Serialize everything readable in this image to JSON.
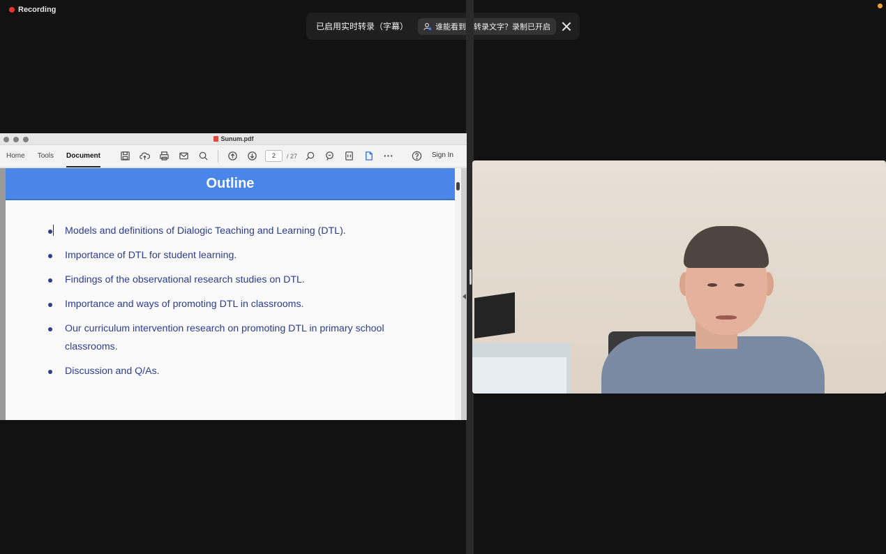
{
  "recording": {
    "label": "Recording"
  },
  "transcript_banner": {
    "text": "已启用实时转录（字幕）",
    "pill_text": "谁能看到此转录文字？录制已开启"
  },
  "pdf_window": {
    "title": "Sunum.pdf",
    "tabs": [
      "Home",
      "Tools",
      "Document"
    ],
    "active_tab": "Document",
    "page_current": "2",
    "page_total": "/ 27",
    "sign_in": "Sign In",
    "toolbar_icons": [
      "save-icon",
      "upload-icon",
      "print-icon",
      "mail-icon",
      "search-icon",
      "page-up-icon",
      "page-down-icon",
      "zoom-select-icon",
      "zoom-icon",
      "fit-page-icon",
      "single-page-icon",
      "more-icon",
      "help-icon"
    ]
  },
  "slide": {
    "heading": "Outline",
    "bullets": [
      "Models and definitions of Dialogic Teaching and Learning (DTL).",
      "Importance of DTL for student learning.",
      "Findings of the observational research studies on DTL.",
      "Importance and ways of promoting DTL in classrooms.",
      "Our curriculum intervention research on promoting DTL in primary school classrooms.",
      "Discussion and Q/As."
    ]
  },
  "colors": {
    "slide_header": "#4a86e8",
    "bullet_text": "#2c3c91",
    "recording_dot": "#e5352b",
    "status_dot": "#f0a030"
  }
}
